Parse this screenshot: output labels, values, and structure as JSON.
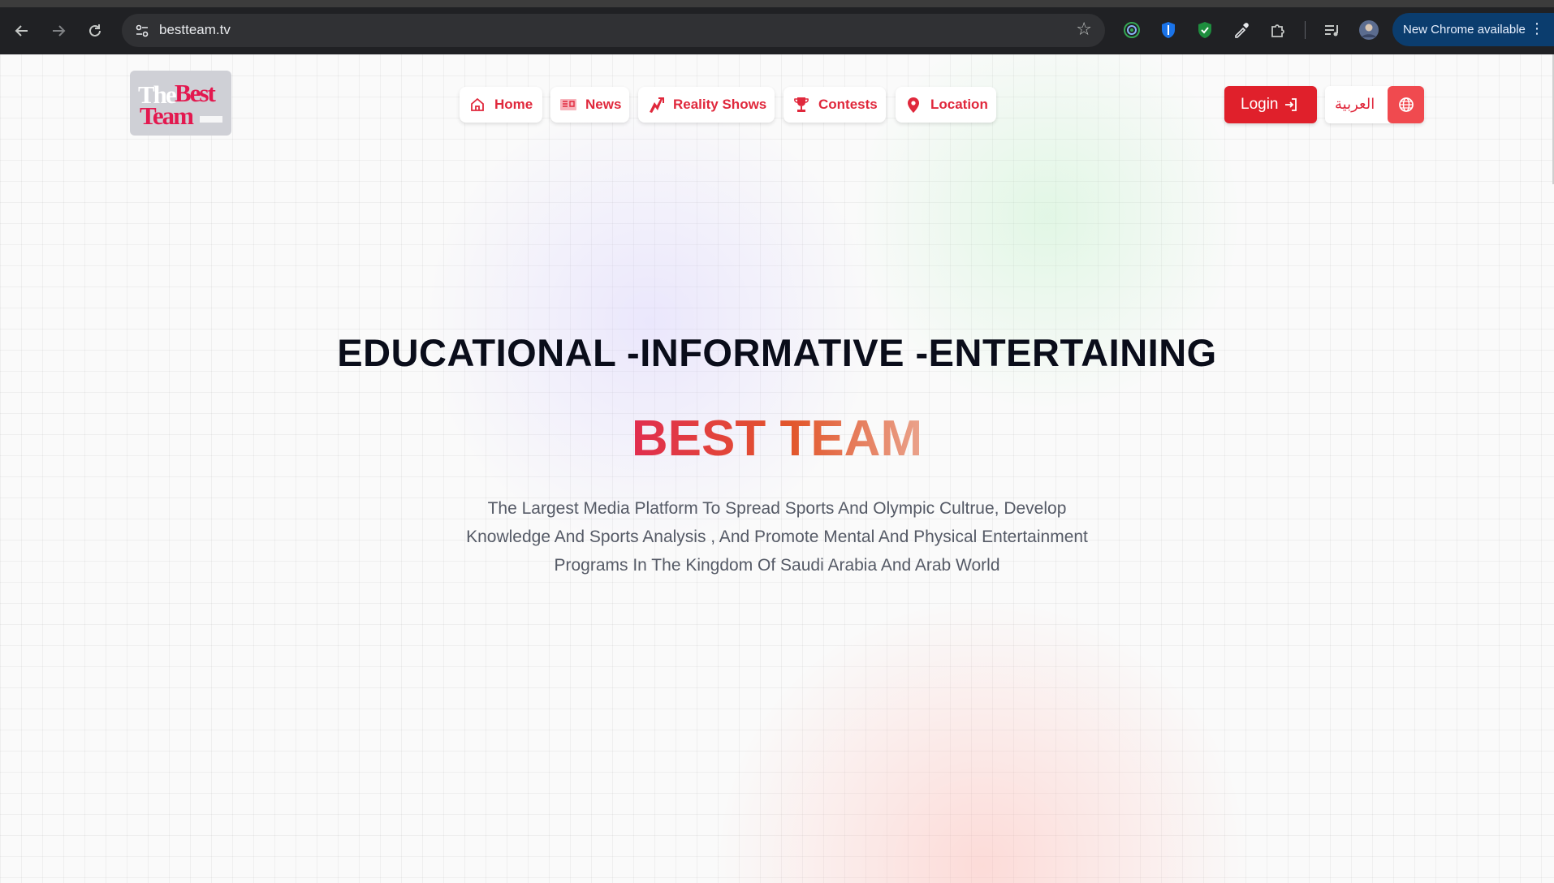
{
  "browser": {
    "url": "bestteam.tv",
    "update_label": "New Chrome available"
  },
  "site": {
    "logo": {
      "word1": "The",
      "word2": "Best",
      "word3": "Team"
    },
    "nav": [
      {
        "label": "Home",
        "icon": "home-icon"
      },
      {
        "label": "News",
        "icon": "newspaper-icon"
      },
      {
        "label": "Reality Shows",
        "icon": "bolt-icon"
      },
      {
        "label": "Contests",
        "icon": "trophy-icon"
      },
      {
        "label": "Location",
        "icon": "location-pin-icon"
      }
    ],
    "login_label": "Login",
    "language_label": "العربية"
  },
  "hero": {
    "tagline": "EDUCATIONAL -INFORMATIVE -ENTERTAINING",
    "brand": "BEST TEAM",
    "description": "The Largest Media Platform To Spread Sports And Olympic Cultrue, Develop Knowledge And Sports Analysis , And Promote Mental And Physical Entertainment Programs In The Kingdom Of Saudi Arabia And Arab World"
  },
  "colors": {
    "accent": "#e0283c",
    "login_bg": "#e0202b",
    "chrome_bg": "#202124"
  }
}
